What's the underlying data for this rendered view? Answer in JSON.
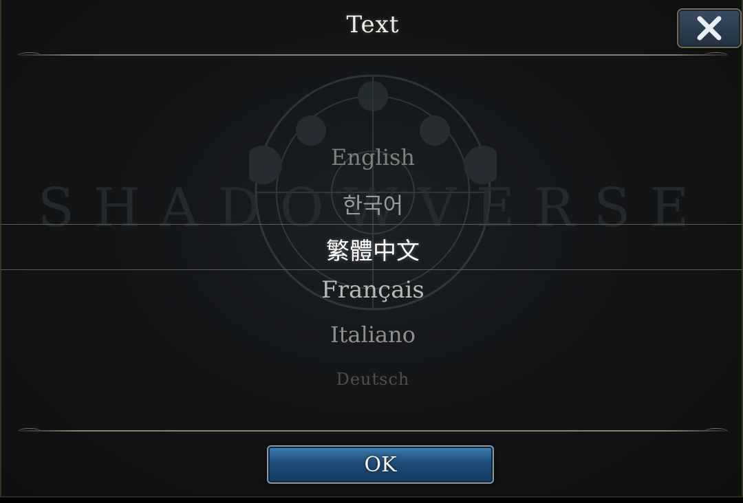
{
  "dialog": {
    "title": "Text",
    "watermark": "SHADOWVERSE",
    "languages": [
      {
        "label": "English",
        "selected": false
      },
      {
        "label": "한국어",
        "selected": false
      },
      {
        "label": "繁體中文",
        "selected": true
      },
      {
        "label": "Français",
        "selected": false
      },
      {
        "label": "Italiano",
        "selected": false
      },
      {
        "label": "Deutsch",
        "selected": false
      }
    ],
    "ok_label": "OK",
    "close_icon": "close-icon"
  }
}
